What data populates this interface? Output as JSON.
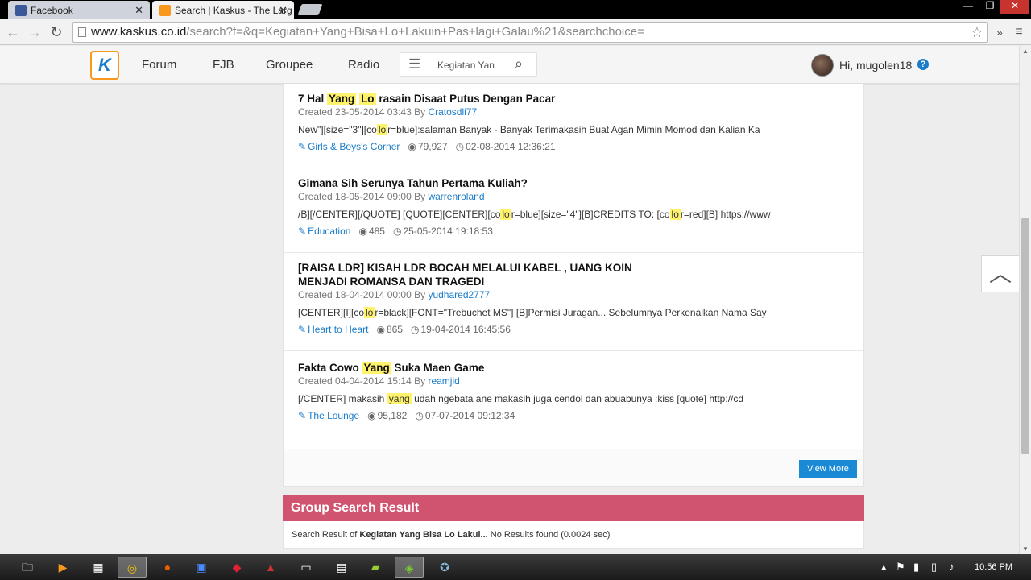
{
  "browser": {
    "tabs": [
      {
        "title": "Facebook",
        "favicon_color": "#3b5998"
      },
      {
        "title": "Search | Kaskus - The Larg",
        "favicon_color": "#f8991d"
      }
    ],
    "url_host": "www.kaskus.co.id",
    "url_path": "/search?f=&q=Kegiatan+Yang+Bisa+Lo+Lakuin+Pas+lagi+Galau%21&searchchoice="
  },
  "header": {
    "logo_letter": "K",
    "nav": [
      "Forum",
      "FJB",
      "Groupee",
      "Radio"
    ],
    "search_value": "Kegiatan Yan",
    "greeting": "Hi, mugolen18",
    "help": "?"
  },
  "results": [
    {
      "title_parts": [
        "7 Hal ",
        "Yang",
        " ",
        "Lo",
        " rasain Disaat Putus Dengan Pacar"
      ],
      "created": "Created 23-05-2014 03:43 By ",
      "author": "Cratosdli77",
      "snippet_parts": [
        "New\"][size=\"3\"][co",
        "lo",
        "r=blue]:salaman Banyak - Banyak Terimakasih Buat Agan Mimin Momod dan Kalian Ka"
      ],
      "category": "Girls & Boys's Corner",
      "views": "79,927",
      "last_post": "02-08-2014 12:36:21"
    },
    {
      "title_parts": [
        "Gimana Sih Serunya Tahun Pertama Kuliah?"
      ],
      "created": "Created 18-05-2014 09:00 By ",
      "author": "warrenroland",
      "snippet_parts": [
        "/B][/CENTER][/QUOTE] [QUOTE][CENTER][co",
        "lo",
        "r=blue][size=\"4\"][B]CREDITS TO: [co",
        "lo",
        "r=red][B] https://www"
      ],
      "category": "Education",
      "views": "485",
      "last_post": "25-05-2014 19:18:53"
    },
    {
      "title_line1": "[RAISA LDR] KISAH LDR BOCAH MELALUI KABEL , UANG KOIN",
      "title_line2": "MENJADI ROMANSA DAN TRAGEDI",
      "created": "Created 18-04-2014 00:00 By ",
      "author": "yudhared2777",
      "snippet_parts": [
        "[CENTER][I][co",
        "lo",
        "r=black][FONT=\"Trebuchet MS\"] [B]Permisi Juragan... Sebelumnya Perkenalkan Nama Say"
      ],
      "category": "Heart to Heart",
      "views": "865",
      "last_post": "19-04-2014 16:45:56"
    },
    {
      "title_parts": [
        "Fakta Cowo ",
        "Yang",
        " Suka Maen Game"
      ],
      "created": "Created 04-04-2014 15:14 By ",
      "author": "reamjid",
      "snippet_parts": [
        "[/CENTER] makasih ",
        "yang",
        " udah ngebata ane makasih juga cendol dan abuabunya :kiss [quote] http://cd"
      ],
      "category": "The Lounge",
      "views": "95,182",
      "last_post": "07-07-2014 09:12:34"
    }
  ],
  "view_more": "View More",
  "group": {
    "heading": "Group Search Result",
    "prefix": "Search Result of ",
    "query": "Kegiatan Yang Bisa Lo Lakui...",
    "suffix": " No Results found (0.0024 sec)"
  },
  "taskbar": {
    "clock": "10:56 PM"
  },
  "colors": {
    "link": "#1b7cc9",
    "highlight": "#fff36b",
    "group_header": "#d0546f",
    "button": "#1b8ad6",
    "logo_border": "#f8991d"
  }
}
